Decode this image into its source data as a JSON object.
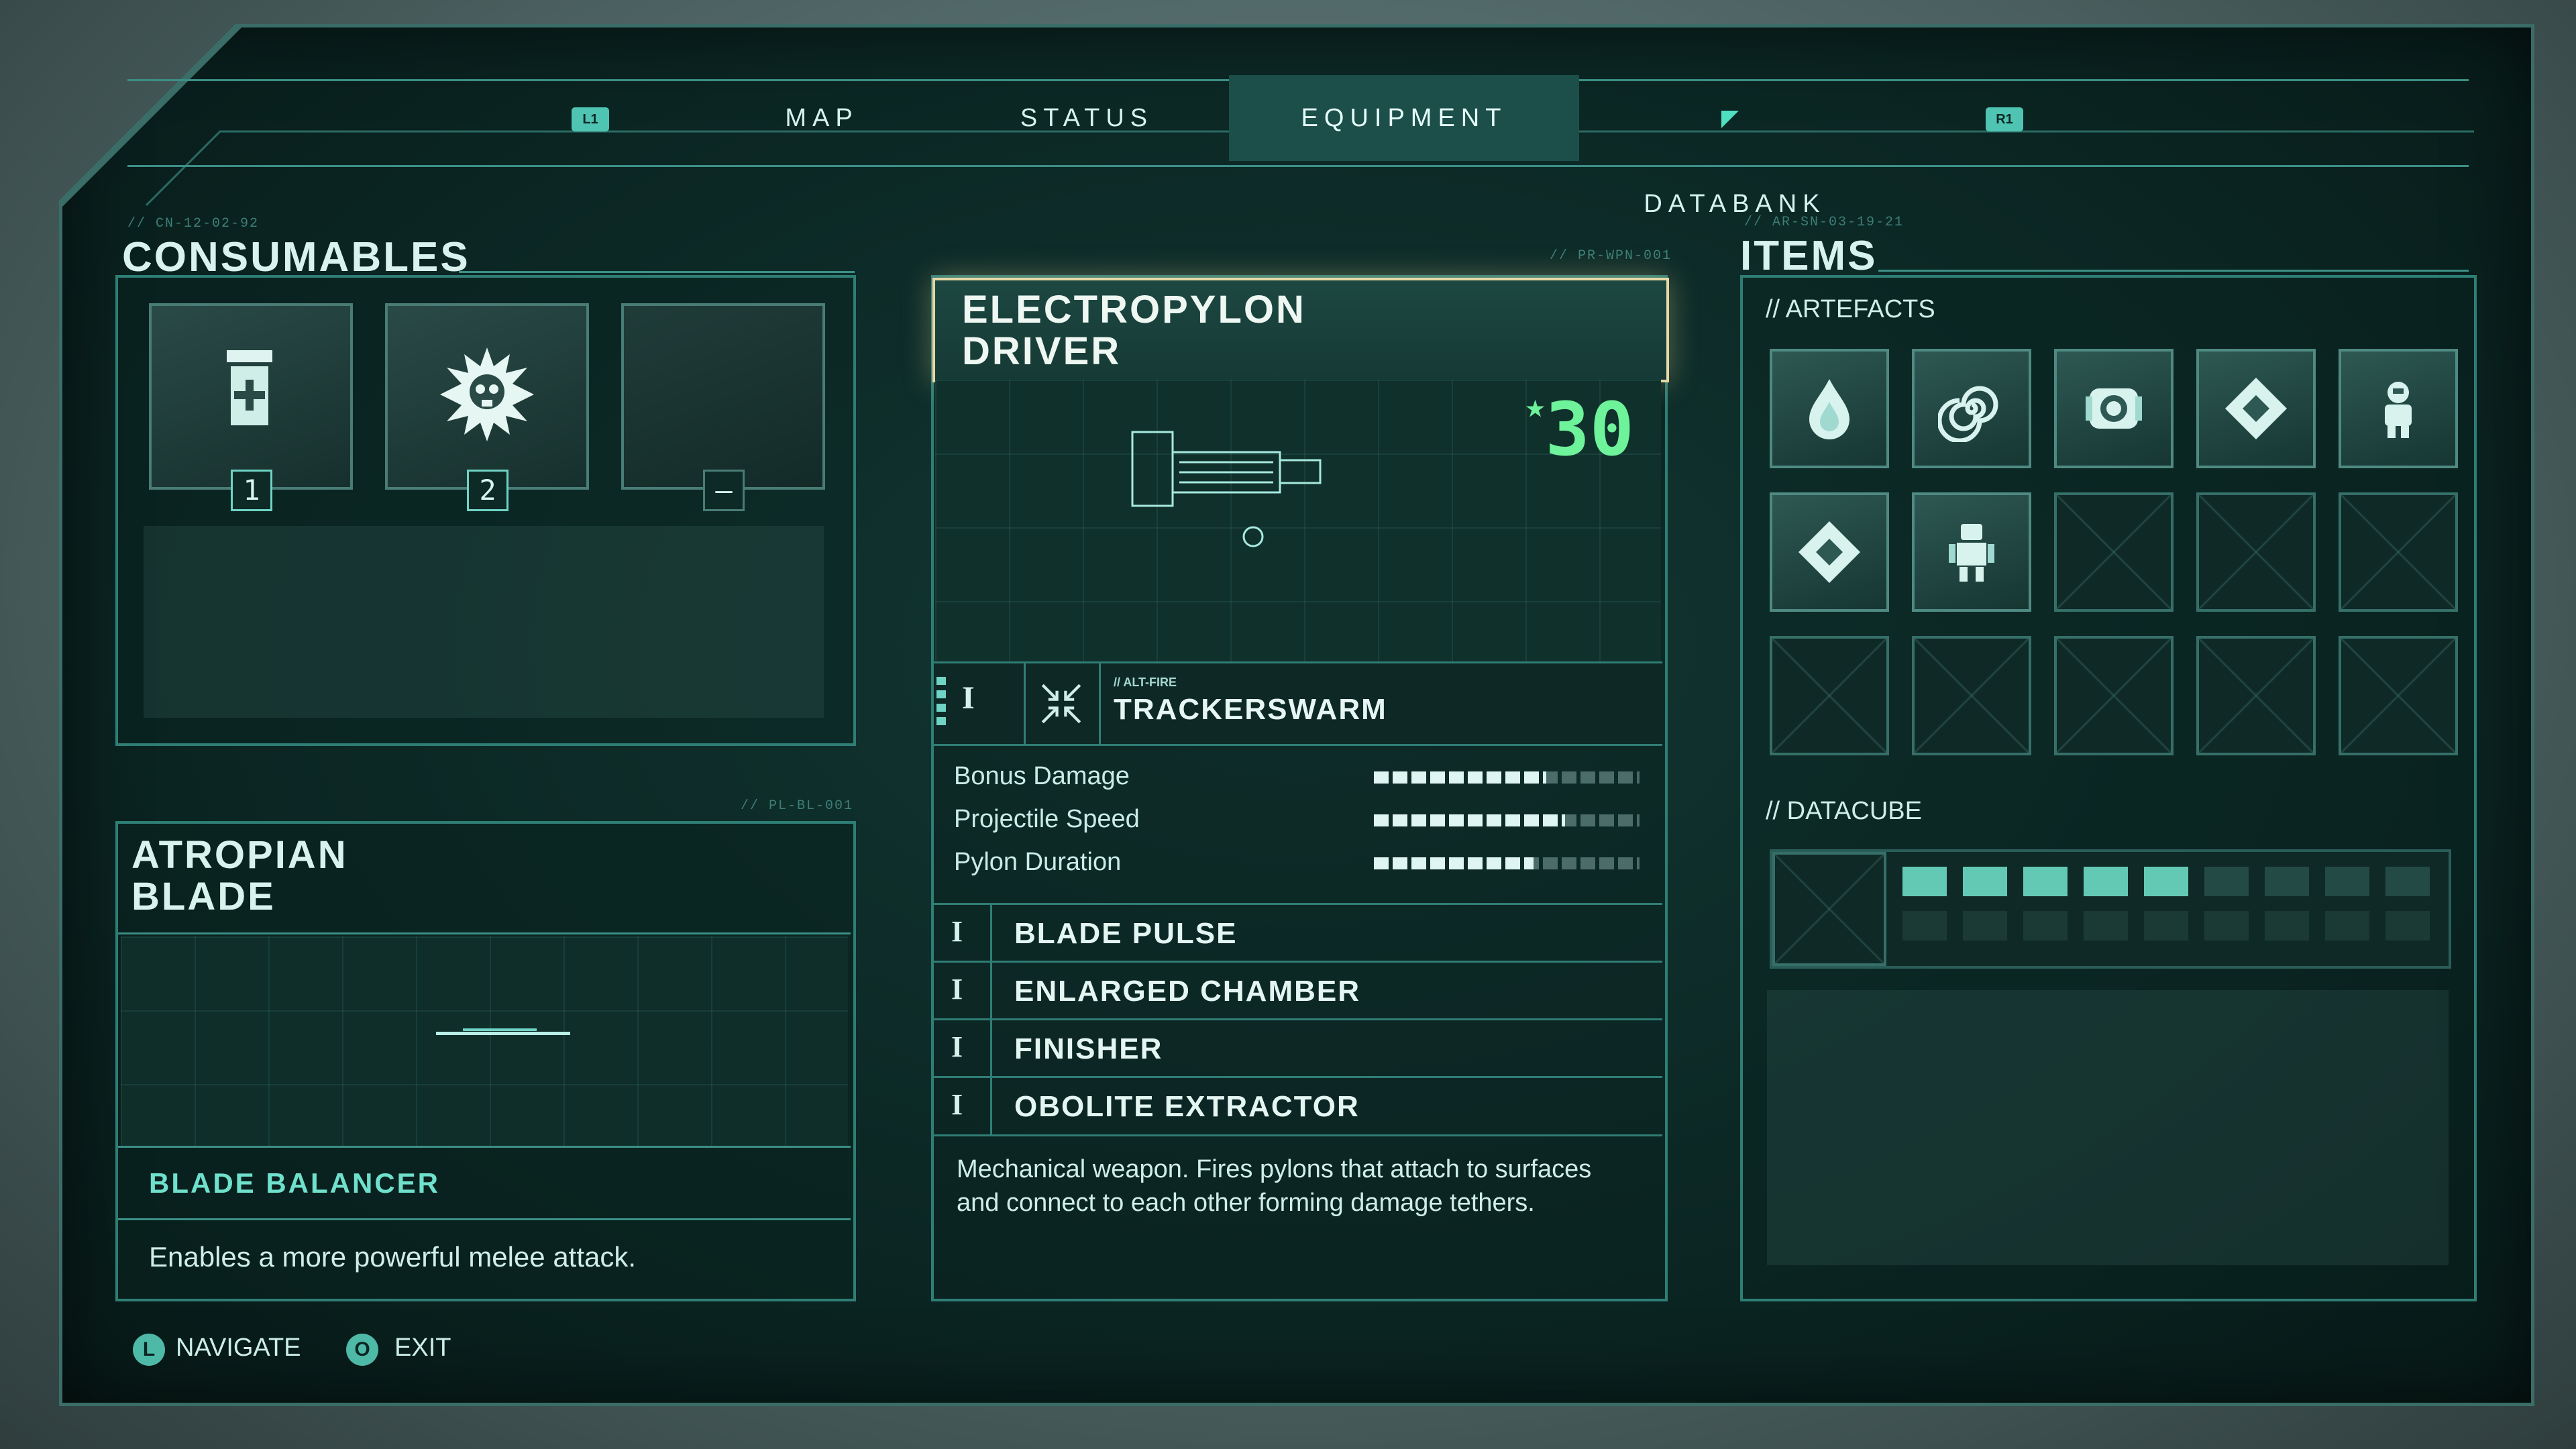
{
  "nav": {
    "left_bumper": "L1",
    "right_bumper": "R1",
    "tabs": [
      {
        "label": "MAP"
      },
      {
        "label": "STATUS"
      },
      {
        "label": "EQUIPMENT",
        "active": true
      },
      {
        "label": "DATABANK"
      }
    ]
  },
  "consumables": {
    "title": "CONSUMABLES",
    "code": "// CN-12-02-92",
    "slots": [
      {
        "icon": "health-canister-icon",
        "qty": "1"
      },
      {
        "icon": "skull-burst-icon",
        "qty": "2"
      },
      {
        "icon": "empty",
        "qty": "–"
      }
    ]
  },
  "melee": {
    "code": "// PL-BL-001",
    "title_line1": "ATROPIAN",
    "title_line2": "BLADE",
    "mod_name": "BLADE BALANCER",
    "mod_desc": "Enables a more powerful melee attack."
  },
  "weapon": {
    "code": "// PR-WPN-001",
    "title_line1": "ELECTROPYLON",
    "title_line2": "DRIVER",
    "level": "30",
    "alt_fire_tag": "// ALT-FIRE",
    "alt_fire_tier": "I",
    "alt_fire_name": "TRACKERSWARM",
    "stats": [
      {
        "label": "Bonus Damage",
        "value": 0.65
      },
      {
        "label": "Projectile Speed",
        "value": 0.72
      },
      {
        "label": "Pylon Duration",
        "value": 0.6
      }
    ],
    "mods": [
      {
        "tier": "I",
        "name": "BLADE PULSE"
      },
      {
        "tier": "I",
        "name": "ENLARGED CHAMBER"
      },
      {
        "tier": "I",
        "name": "FINISHER"
      },
      {
        "tier": "I",
        "name": "OBOLITE EXTRACTOR"
      }
    ],
    "description": "Mechanical weapon. Fires pylons that attach to surfaces and connect to each other forming damage tethers."
  },
  "items": {
    "title": "ITEMS",
    "code": "// AR-SN-03-19-21",
    "artefacts_label": "// ARTEFACTS",
    "artefacts": [
      "flame-drop-icon",
      "spiral-icon",
      "cylinder-core-icon",
      "diamond-sigil-icon",
      "astronaut-icon",
      "diamond-sigil-icon",
      "robot-figure-icon",
      "empty",
      "empty",
      "empty",
      "empty",
      "empty",
      "empty",
      "empty",
      "empty"
    ],
    "datacube_label": "// DATACUBE",
    "datacube_collected": 5,
    "datacube_total": 9
  },
  "footer": {
    "navigate_key": "L",
    "navigate_label": "NAVIGATE",
    "exit_key": "O",
    "exit_label": "EXIT"
  },
  "colors": {
    "accent": "#4fc4b3",
    "panel_border": "#2f7e75",
    "highlight_border": "#e6d8a6",
    "level_green": "#6ef29a"
  }
}
